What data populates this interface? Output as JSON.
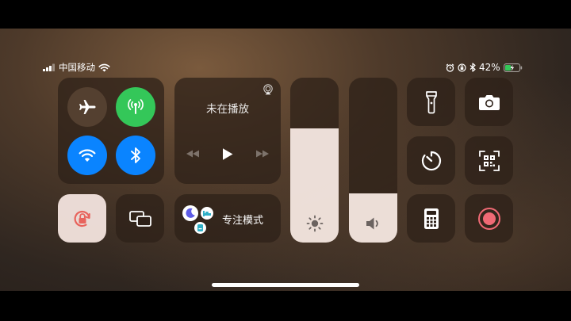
{
  "status_bar": {
    "carrier": "中国移动",
    "battery_percent": "42%",
    "battery_level": 0.42
  },
  "connectivity": {
    "airplane": {
      "icon": "airplane-icon",
      "on": false
    },
    "cellular": {
      "icon": "cellular-antenna-icon",
      "on": true,
      "color": "#34c759"
    },
    "wifi": {
      "icon": "wifi-icon",
      "on": true,
      "color": "#0a84ff"
    },
    "bluetooth": {
      "icon": "bluetooth-icon",
      "on": true,
      "color": "#0a84ff"
    }
  },
  "now_playing": {
    "title": "未在播放",
    "controls": [
      "previous-icon",
      "play-icon",
      "next-icon"
    ],
    "airplay_icon": "airplay-icon"
  },
  "focus": {
    "label": "专注模式",
    "icons": [
      "moon-icon",
      "bed-icon",
      "badge-icon"
    ]
  },
  "sliders": {
    "brightness": {
      "icon": "sun-icon",
      "level": 0.69
    },
    "volume": {
      "icon": "speaker-icon",
      "level": 0.3
    }
  },
  "toggles": {
    "orientation_lock": {
      "icon": "orientation-lock-icon",
      "on": true
    },
    "screen_mirroring": {
      "icon": "screen-mirroring-icon"
    },
    "flashlight": {
      "icon": "flashlight-icon"
    },
    "camera": {
      "icon": "camera-icon"
    },
    "timer": {
      "icon": "timer-icon"
    },
    "qr_scanner": {
      "icon": "qr-scanner-icon"
    },
    "calculator": {
      "icon": "calculator-icon"
    },
    "screen_recording": {
      "icon": "record-icon"
    }
  },
  "colors": {
    "accent_green": "#34c759",
    "accent_blue": "#0a84ff",
    "lock_red": "#e8635c",
    "record_red": "#f06a75"
  }
}
